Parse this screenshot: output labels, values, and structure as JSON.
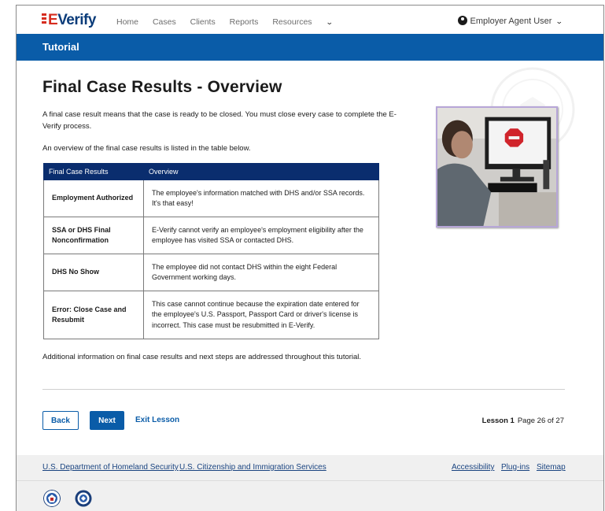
{
  "nav": {
    "logo_e": "E",
    "logo_rest": "Verify",
    "links": [
      "Home",
      "Cases",
      "Clients",
      "Reports",
      "Resources"
    ],
    "user_label": "Employer Agent User"
  },
  "banner": {
    "title": "Tutorial"
  },
  "main": {
    "title": "Final Case Results - Overview",
    "intro": "A final case result means that the case is ready to be closed. You must close every case to complete the E-Verify process.",
    "table_intro": "An overview of the final case results is listed in the table below.",
    "table_headers": [
      "Final Case Results",
      "Overview"
    ],
    "rows": [
      {
        "term": "Employment Authorized",
        "overview": "The employee's information matched with DHS and/or SSA records. It's that easy!"
      },
      {
        "term": "SSA or DHS Final Nonconfirmation",
        "overview": "E-Verify cannot verify an employee's employment eligibility after the employee has visited SSA or contacted DHS."
      },
      {
        "term": "DHS No Show",
        "overview": "The employee did not contact DHS within the eight Federal Government working days."
      },
      {
        "term": "Error: Close Case and Resubmit",
        "overview": "This case cannot continue because the expiration date entered for the employee's U.S. Passport, Passport Card or driver's license is incorrect. This case must be resubmitted in E-Verify."
      }
    ],
    "closing": "Additional information on final case results and next steps are addressed throughout this tutorial."
  },
  "controls": {
    "back": "Back",
    "next": "Next",
    "exit": "Exit Lesson",
    "lesson_label": "Lesson 1",
    "page_label": "Page 26 of 27"
  },
  "footer": {
    "links_left": [
      "U.S. Department of Homeland Security",
      "U.S. Citizenship and Immigration Services"
    ],
    "links_right": [
      "Accessibility",
      "Plug-ins",
      "Sitemap"
    ]
  },
  "colors": {
    "primary": "#0a5ca8",
    "table_header": "#0a2d6e",
    "stop_sign": "#d0242b"
  }
}
